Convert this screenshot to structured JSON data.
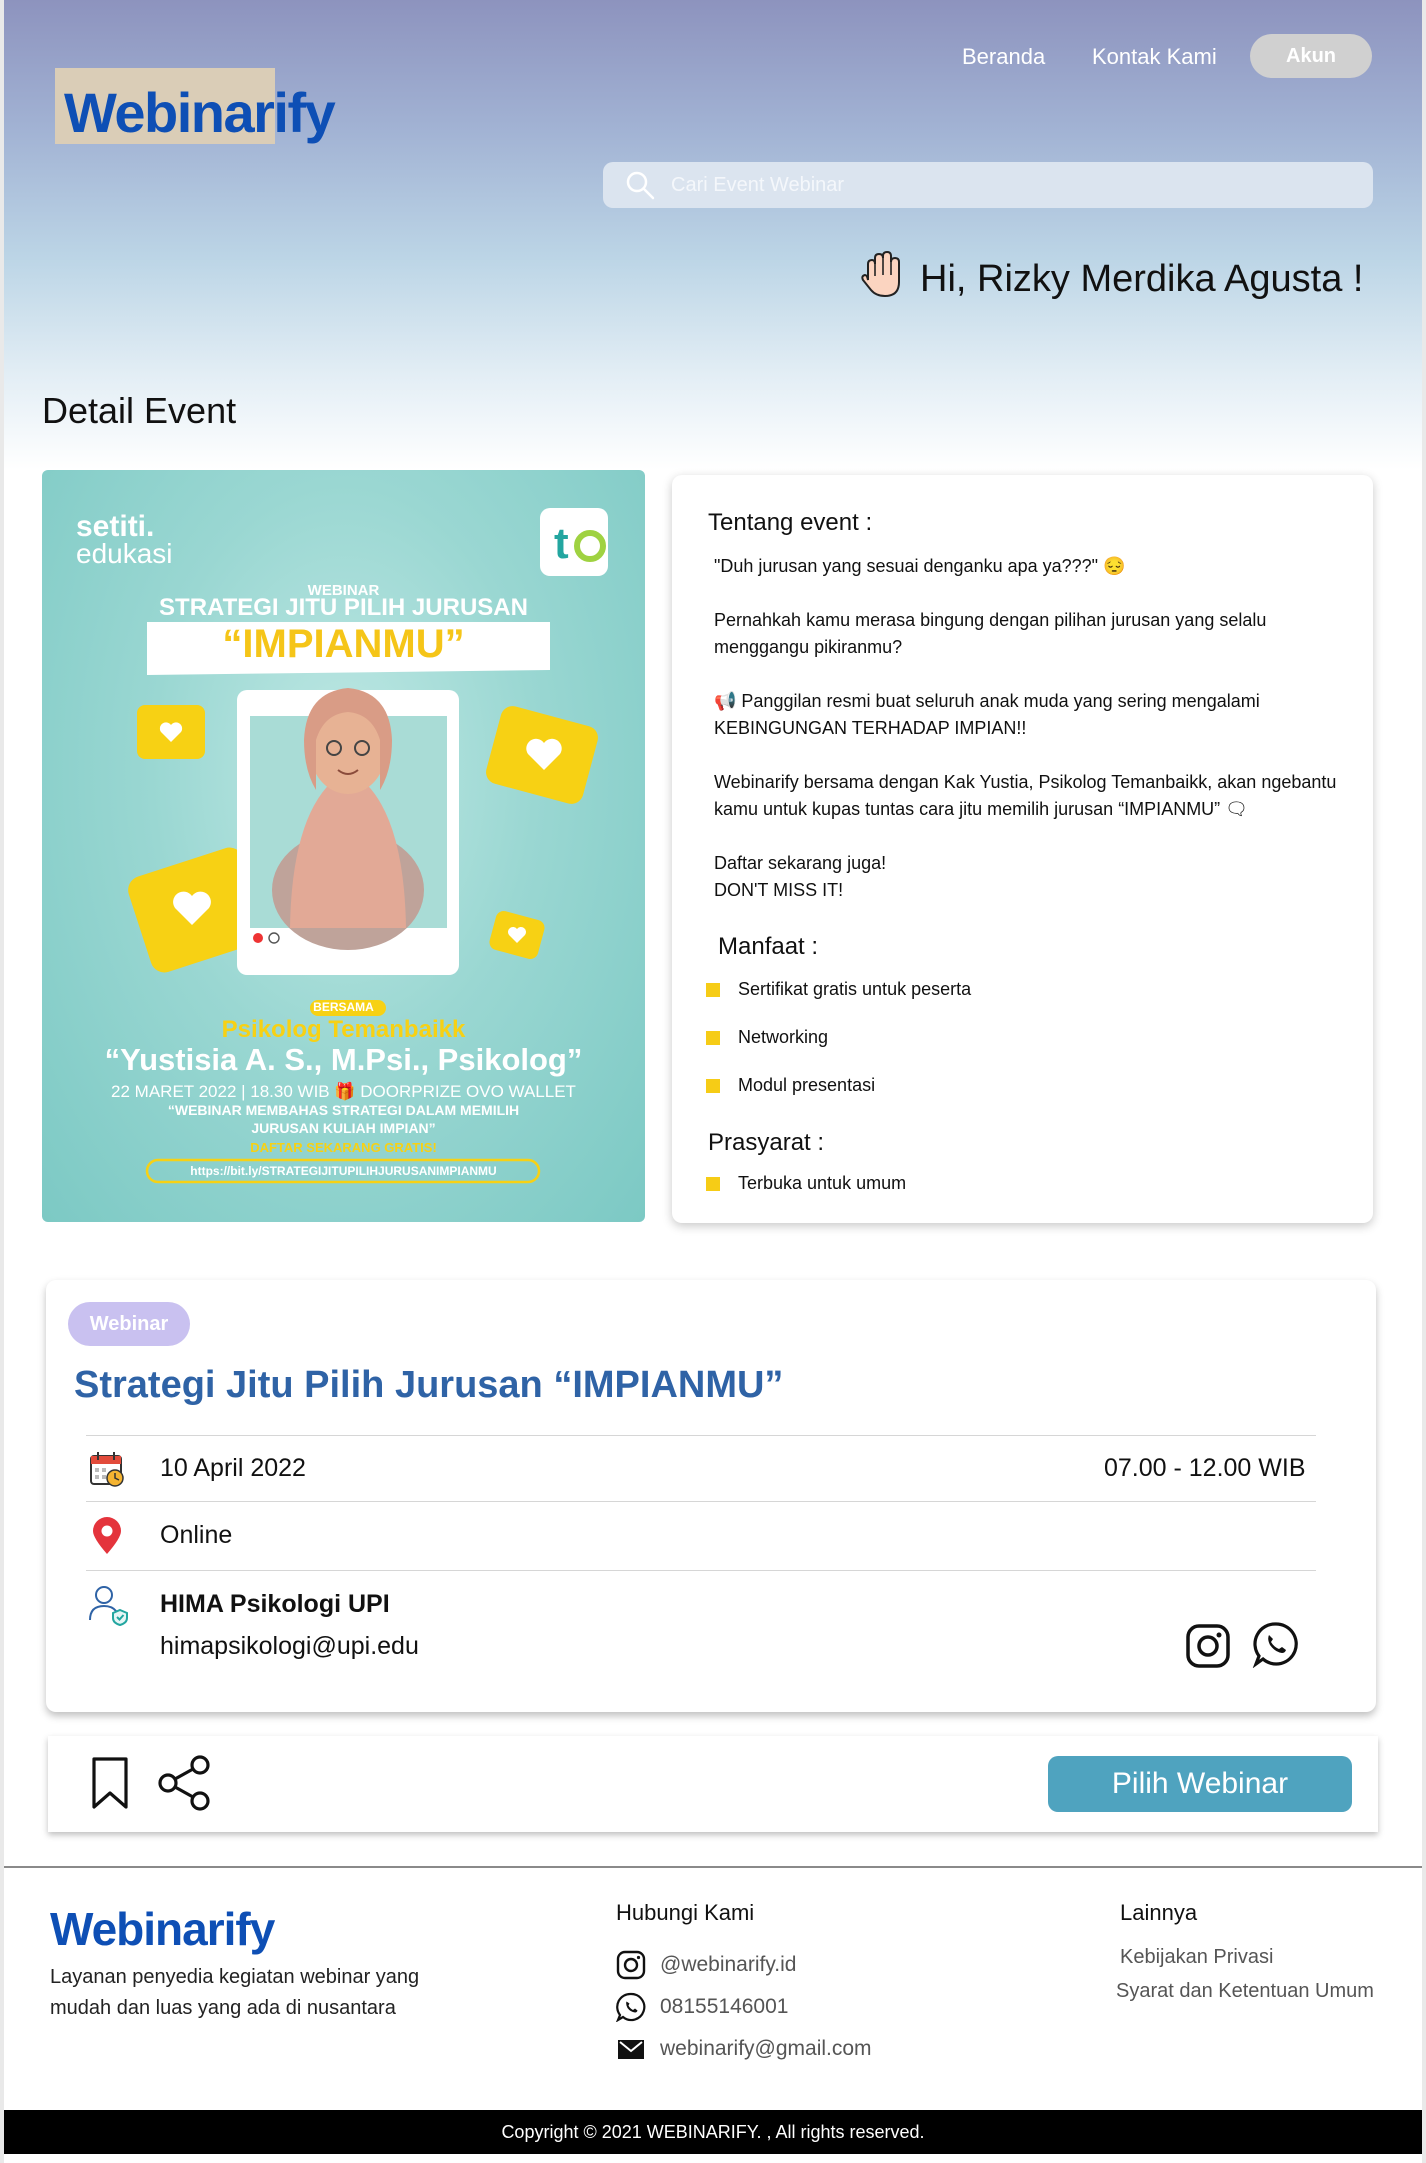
{
  "header": {
    "logo": "Webinarify",
    "nav": {
      "home": "Beranda",
      "contact": "Kontak Kami",
      "account": "Akun"
    },
    "search": {
      "placeholder": "Cari Event Webinar"
    },
    "greeting": "Hi, Rizky Merdika Agusta !"
  },
  "page": {
    "section_title": "Detail Event"
  },
  "poster": {
    "brand_top": "setiti.",
    "brand_bottom": "edukasi",
    "webinar_label": "WEBINAR",
    "headline": "STRATEGI JITU PILIH JURUSAN",
    "highlight": "“IMPIANMU”",
    "with_label": "BERSAMA",
    "org": "Psikolog Temanbaikk",
    "speaker": "“Yustisia A. S., M.Psi., Psikolog”",
    "date_line": "22 MARET 2022 | 18.30 WIB 🎁 DOORPRIZE OVO WALLET",
    "desc_line1": "“WEBINAR MEMBAHAS STRATEGI DALAM MEMILIH",
    "desc_line2": "JURUSAN KULIAH IMPIAN”",
    "cta": "DAFTAR SEKARANG GRATIS!",
    "link": "https://bit.ly/STRATEGIJITUPILIHJURUSANIMPIANMU"
  },
  "about": {
    "heading": "Tentang event :",
    "p1": "\"Duh jurusan yang sesuai denganku apa ya???\" 😔",
    "p2": "Pernahkah kamu merasa bingung dengan pilihan jurusan yang selalu menggangu pikiranmu?",
    "p3": "📢 Panggilan resmi buat seluruh anak muda yang sering mengalami KEBINGUNGAN TERHADAP IMPIAN!!",
    "p4": "Webinarify bersama dengan Kak Yustia, Psikolog Temanbaikk, akan ngebantu kamu untuk kupas tuntas cara jitu memilih jurusan “IMPIANMU” 🗨",
    "p5": "Daftar sekarang juga!",
    "p6": "DON'T MISS IT!",
    "benefits_heading": "Manfaat :",
    "benefits": [
      "Sertifikat gratis untuk peserta",
      "Networking",
      "Modul presentasi"
    ],
    "req_heading": "Prasyarat :",
    "requirements": [
      "Terbuka untuk umum"
    ]
  },
  "event": {
    "badge": "Webinar",
    "title": "Strategi Jitu Pilih Jurusan “IMPIANMU”",
    "date": "10 April 2022",
    "time": "07.00 - 12.00 WIB",
    "location": "Online",
    "organizer": "HIMA Psikologi UPI",
    "email": "himapsikologi@upi.edu"
  },
  "actions": {
    "select": "Pilih Webinar"
  },
  "footer": {
    "logo": "Webinarify",
    "description": "Layanan penyedia kegiatan webinar yang mudah dan luas yang ada di nusantara",
    "contact_heading": "Hubungi Kami",
    "instagram": "@webinarify.id",
    "whatsapp": "08155146001",
    "email": "webinarify@gmail.com",
    "other_heading": "Lainnya",
    "privacy": "Kebijakan Privasi",
    "terms": "Syarat dan Ketentuan Umum",
    "copyright": "Copyright © 2021 WEBINARIFY. , All rights reserved."
  },
  "colors": {
    "brand_blue": "#0e4fb5",
    "title_blue": "#2f63a6",
    "button_teal": "#4fa3bf",
    "badge_lilac": "#c9c1f0",
    "bullet_yellow": "#f6cc16"
  }
}
